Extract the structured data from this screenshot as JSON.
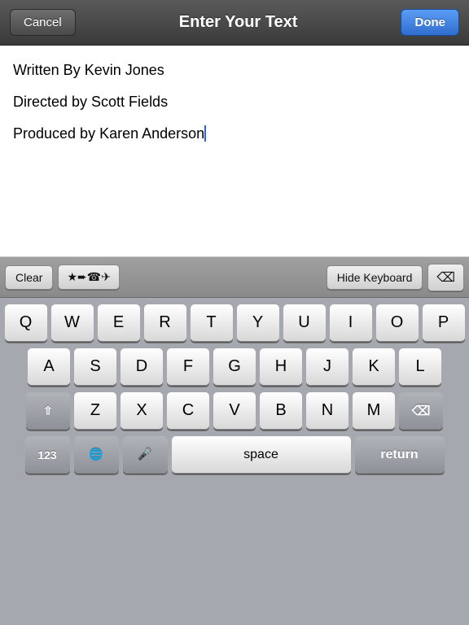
{
  "nav": {
    "cancel_label": "Cancel",
    "title": "Enter Your Text",
    "done_label": "Done"
  },
  "text_editor": {
    "lines": [
      "Written By Kevin Jones",
      "Directed by Scott Fields",
      "Produced by Karen Anderson"
    ]
  },
  "toolbar": {
    "clear_label": "Clear",
    "symbols_label": "★➨☎✈",
    "hide_keyboard_label": "Hide Keyboard",
    "delete_label": "⌫"
  },
  "keyboard": {
    "row1": [
      "Q",
      "W",
      "E",
      "R",
      "T",
      "Y",
      "U",
      "I",
      "O",
      "P"
    ],
    "row2": [
      "A",
      "S",
      "D",
      "F",
      "G",
      "H",
      "J",
      "K",
      "L"
    ],
    "row3": [
      "Z",
      "X",
      "C",
      "V",
      "B",
      "N",
      "M"
    ],
    "bottom": {
      "num_label": "123",
      "globe_label": "🌐",
      "mic_label": "🎤",
      "space_label": "space",
      "return_label": "return"
    }
  }
}
